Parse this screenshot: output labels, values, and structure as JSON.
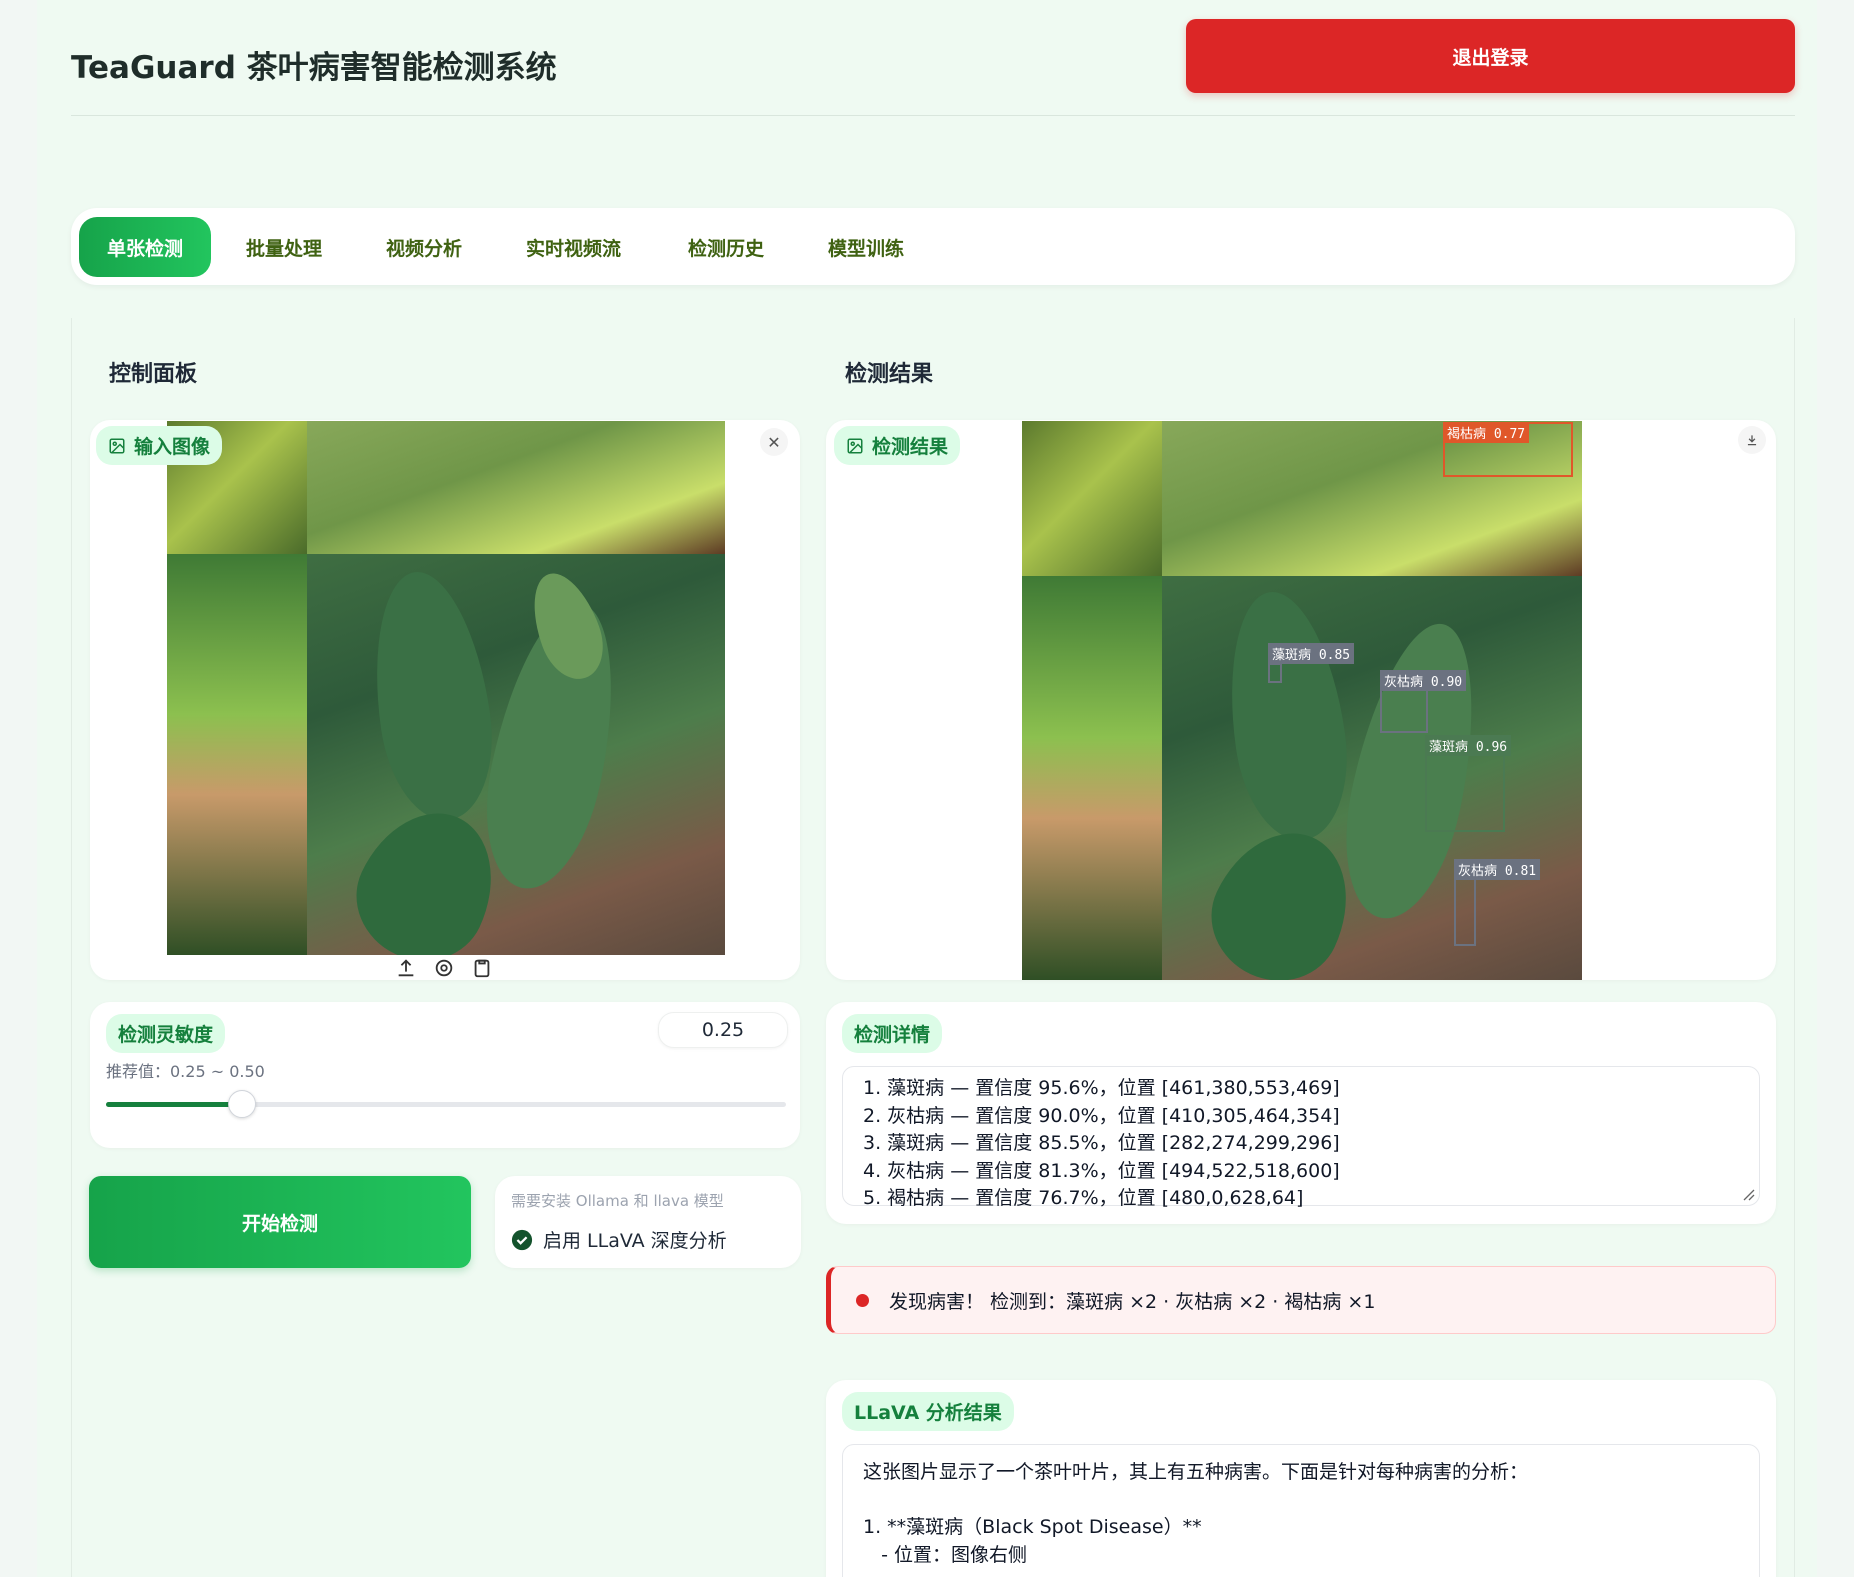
{
  "header": {
    "title": "TeaGuard 茶叶病害智能检测系统",
    "logout_label": "退出登录"
  },
  "tabs": [
    {
      "label": "单张检测",
      "active": true
    },
    {
      "label": "批量处理",
      "active": false
    },
    {
      "label": "视频分析",
      "active": false
    },
    {
      "label": "实时视频流",
      "active": false
    },
    {
      "label": "检测历史",
      "active": false
    },
    {
      "label": "模型训练",
      "active": false
    }
  ],
  "control_panel": {
    "title": "控制面板",
    "input_image_label": "输入图像",
    "sensitivity": {
      "label": "检测灵敏度",
      "value": "0.25",
      "hint": "推荐值：0.25 ~ 0.50",
      "slider_fraction": 0.2
    },
    "start_button": "开始检测",
    "llava": {
      "hint": "需要安装 Ollama 和 llava 模型",
      "checkbox_label": "启用 LLaVA 深度分析",
      "checked": true
    }
  },
  "results": {
    "title": "检测结果",
    "result_image_label": "检测结果",
    "detections": [
      {
        "label": "褐枯病 0.77",
        "color": "#e0572a"
      },
      {
        "label": "藻斑病 0.85",
        "color": "#6b7280"
      },
      {
        "label": "灰枯病 0.90",
        "color": "#6b7280"
      },
      {
        "label": "藻斑病 0.96",
        "color": "#4b7a52"
      },
      {
        "label": "灰枯病 0.81",
        "color": "#6b7280"
      }
    ],
    "details_label": "检测详情",
    "details": [
      "1. 藻斑病 — 置信度 95.6%，位置 [461,380,553,469]",
      "2. 灰枯病 — 置信度 90.0%，位置 [410,305,464,354]",
      "3. 藻斑病 — 置信度 85.5%，位置 [282,274,299,296]",
      "4. 灰枯病 — 置信度 81.3%，位置 [494,522,518,600]",
      "5. 褐枯病 — 置信度 76.7%，位置 [480,0,628,64]"
    ],
    "alert": "发现病害！ 检测到：藻斑病 ×2 · 灰枯病 ×2 · 褐枯病 ×1",
    "llava_label": "LLaVA 分析结果",
    "llava_lines": [
      "这张图片显示了一个茶叶叶片，其上有五种病害。下面是针对每种病害的分析：",
      "",
      "1. **藻斑病（Black Spot Disease）**",
      "   - 位置：图像右侧"
    ]
  },
  "colors": {
    "accent": "#16a34a",
    "danger": "#dc2626",
    "badge_bg": "#dcfce7"
  }
}
